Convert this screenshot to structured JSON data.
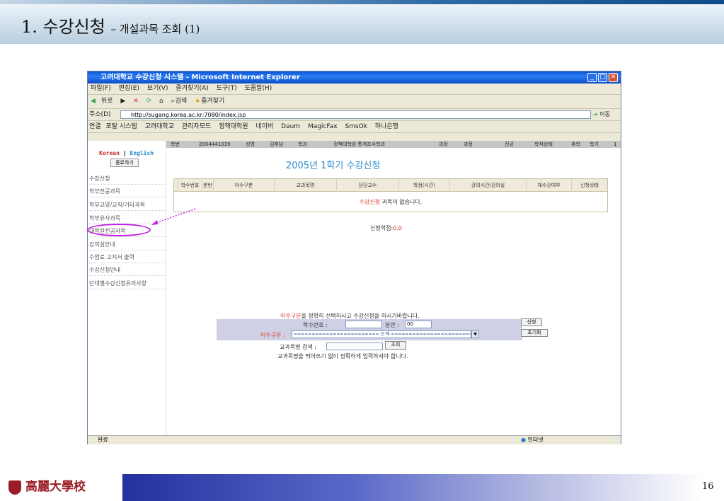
{
  "slide": {
    "title": "1. 수강신청",
    "subtitle": "– 개설과목 조회 (1)",
    "page_number": "16",
    "logo_text": "高麗大學校"
  },
  "window": {
    "title": "고려대학교 수강신청 시스템 - Microsoft Internet Explorer"
  },
  "menu": [
    "파일(F)",
    "편집(E)",
    "보기(V)",
    "즐겨찾기(A)",
    "도구(T)",
    "도움말(H)"
  ],
  "toolbar": [
    "뒤로",
    "검색",
    "즐겨찾기"
  ],
  "address": {
    "label": "주소(D)",
    "url": "http://sugang.korea.ac.kr:7080/index.jsp",
    "go": "이동"
  },
  "links": {
    "label": "연결",
    "items": [
      "포탈 시스템",
      "고려대학교",
      "관리자모드",
      "정책대학원",
      "네이버",
      "Daum",
      "MagicFax",
      "SmsOk",
      "하나은행"
    ]
  },
  "infobar": [
    {
      "label": "학번",
      "value": "2004441039"
    },
    {
      "label": "성명",
      "value": "김후남"
    },
    {
      "label": "학과",
      "value": "정책대학원 통계조사학과"
    },
    {
      "label": "과정",
      "value": "석사과정"
    },
    {
      "label": "전공",
      "value": ""
    },
    {
      "label": "학적상태",
      "value": "휴학"
    },
    {
      "label": "학기",
      "value": "1"
    }
  ],
  "sidebar": {
    "lang_korean": "Korean",
    "lang_sep": "|",
    "lang_english": "English",
    "logout": "종료하기",
    "items": [
      "수강신청",
      "학부전공과목",
      "학부교양/교직/기타과목",
      "학부유사과목",
      "대학원전공과목",
      "강의실안내",
      "수업료 고지서 출력",
      "수강신청안내",
      "단대별수강신청유의사항"
    ]
  },
  "main": {
    "title": "2005년 1학기 수강신청",
    "columns": [
      "학수번호",
      "분반",
      "이수구분",
      "교과목명",
      "담당교수",
      "학점(시간)",
      "강의시간/강의실",
      "재수강여부",
      "신청상태"
    ],
    "empty_red": "수강신청",
    "empty_rest": " 과목이 없습니다.",
    "credits_label": "신청학점:",
    "credits_value": "0.0"
  },
  "form": {
    "instr_red": "이수구분",
    "instr_rest": "을 정확히 선택하시고 수강신청을 하시기바랍니다.",
    "course_no_label": "학수번호 :",
    "section_label": "분반 :",
    "section_value": "00",
    "type_label": "이수구분 :",
    "type_select": "======================== 선 택 ========================",
    "apply": "신청",
    "reset": "초기화",
    "search_label": "교과목명 검색 :",
    "search_button": "조회",
    "search_note": "교과목명을 띄어쓰기 없이 정확하게 입력하셔야 합니다."
  },
  "status": {
    "left": "완료",
    "right": "인터넷"
  }
}
